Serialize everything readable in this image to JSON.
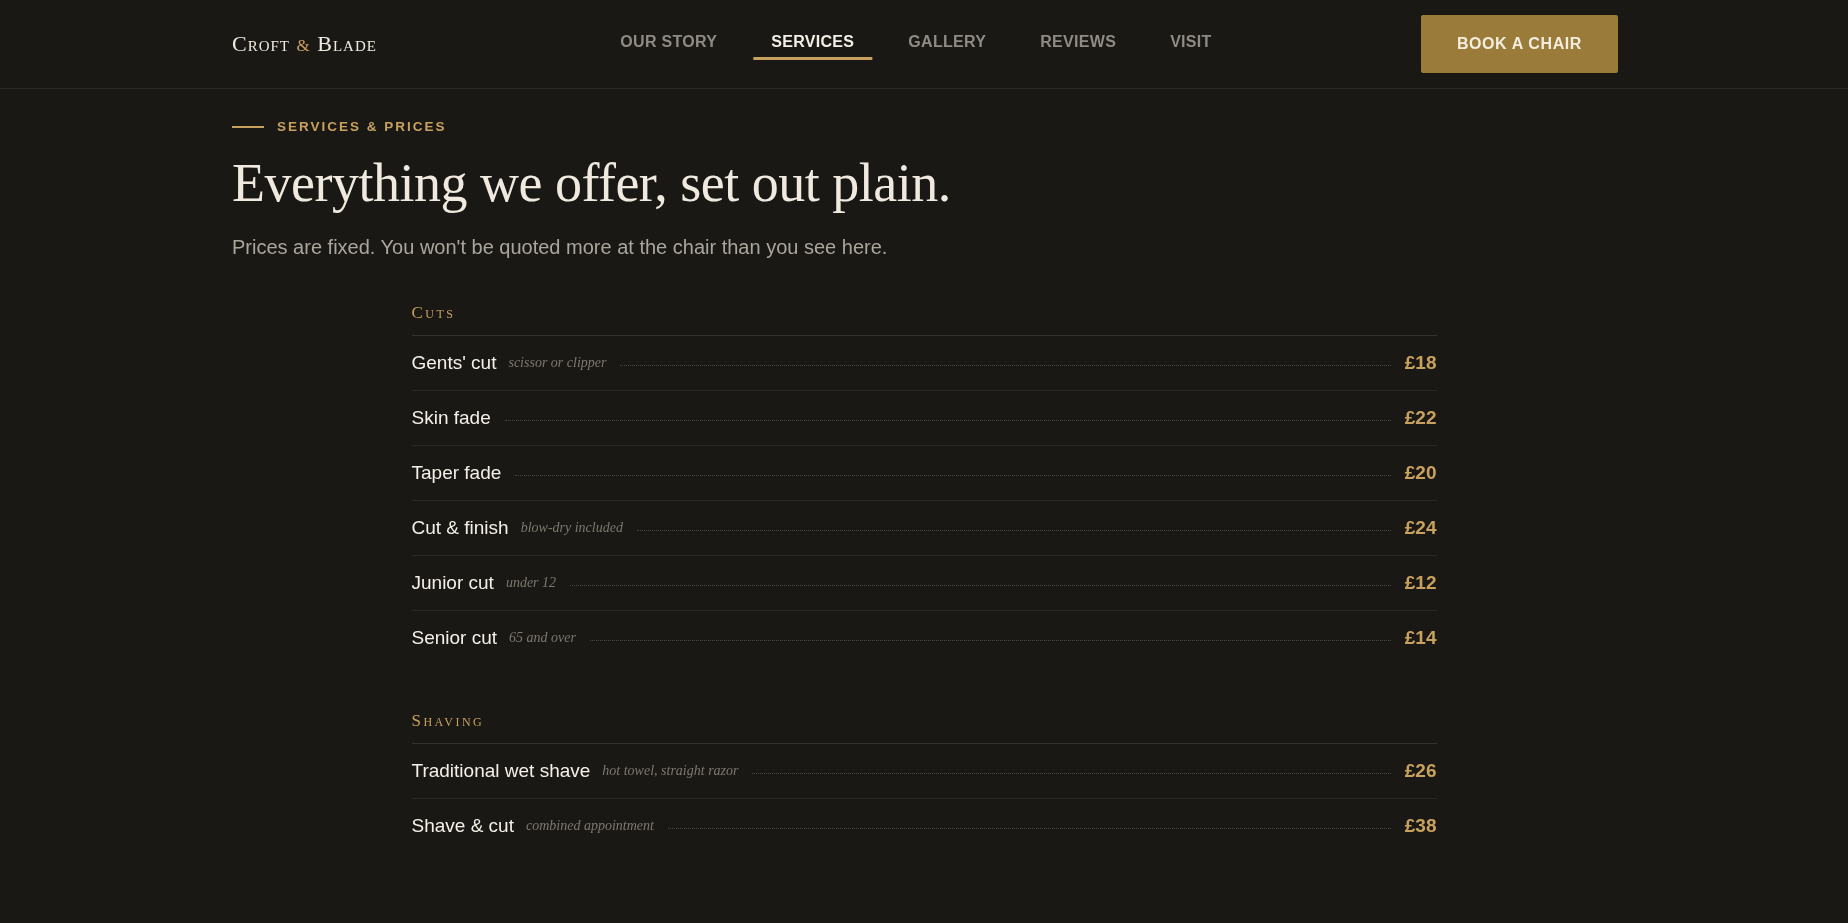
{
  "header": {
    "logo": [
      {
        "text": "Croft",
        "accent": false
      },
      {
        "text": "&",
        "accent": true
      },
      {
        "text": "Blade",
        "accent": false
      }
    ],
    "nav": [
      {
        "label": "OUR STORY",
        "selected": false
      },
      {
        "label": "SERVICES",
        "selected": true
      },
      {
        "label": "GALLERY",
        "selected": false
      },
      {
        "label": "REVIEWS",
        "selected": false
      },
      {
        "label": "VISIT",
        "selected": false
      }
    ],
    "cta": "BOOK A CHAIR"
  },
  "intro": {
    "eyebrow": "SERVICES & PRICES",
    "title": "Everything we offer, set out plain.",
    "lead": "Prices are fixed. You won't be quoted more at the chair than you see here."
  },
  "sections": [
    {
      "title": "Cuts",
      "items": [
        {
          "name": "Gents' cut",
          "note": "scissor or clipper",
          "price": "£18"
        },
        {
          "name": "Skin fade",
          "price": "£22"
        },
        {
          "name": "Taper fade",
          "price": "£20"
        },
        {
          "name": "Cut & finish",
          "note": "blow-dry included",
          "price": "£24"
        },
        {
          "name": "Junior cut",
          "note": "under 12",
          "price": "£12"
        },
        {
          "name": "Senior cut",
          "note": "65 and over",
          "price": "£14"
        }
      ]
    },
    {
      "title": "Shaving",
      "items": [
        {
          "name": "Traditional wet shave",
          "note": "hot towel, straight razor",
          "price": "£26"
        },
        {
          "name": "Shave & cut",
          "note": "combined appointment",
          "price": "£38"
        }
      ]
    }
  ]
}
